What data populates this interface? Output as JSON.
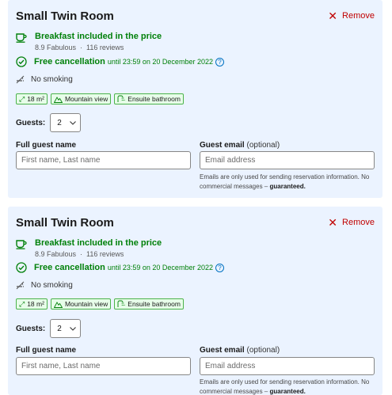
{
  "rooms": [
    {
      "title": "Small Twin Room",
      "remove_label": "Remove",
      "breakfast": "Breakfast included in the price",
      "rating_score": "8.9 Fabulous",
      "rating_reviews": "116 reviews",
      "rating_sep": "·",
      "cancel_label": "Free cancellation",
      "cancel_until": "until 23:59 on 20 December 2022",
      "help_glyph": "?",
      "no_smoking": "No smoking",
      "facilities": [
        "18 m²",
        "Mountain view",
        "Ensuite bathroom"
      ],
      "guests_label": "Guests:",
      "guests_value": "2",
      "name_label": "Full guest name",
      "name_placeholder": "First name, Last name",
      "email_label": "Guest email",
      "email_optional": "(optional)",
      "email_placeholder": "Email address",
      "email_note": "Emails are only used for sending reservation information. No commercial messages –",
      "email_note_bold": "guaranteed."
    },
    {
      "title": "Small Twin Room",
      "remove_label": "Remove",
      "breakfast": "Breakfast included in the price",
      "rating_score": "8.9 Fabulous",
      "rating_reviews": "116 reviews",
      "rating_sep": "·",
      "cancel_label": "Free cancellation",
      "cancel_until": "until 23:59 on 20 December 2022",
      "help_glyph": "?",
      "no_smoking": "No smoking",
      "facilities": [
        "18 m²",
        "Mountain view",
        "Ensuite bathroom"
      ],
      "guests_label": "Guests:",
      "guests_value": "2",
      "name_label": "Full guest name",
      "name_placeholder": "First name, Last name",
      "email_label": "Guest email",
      "email_optional": "(optional)",
      "email_placeholder": "Email address",
      "email_note": "Emails are only used for sending reservation information. No commercial messages –",
      "email_note_bold": "guaranteed."
    }
  ],
  "icons": {
    "remove": "close-icon",
    "breakfast": "coffee-cup-icon",
    "cancel": "check-circle-icon",
    "no_smoking": "no-smoking-icon",
    "size": "room-size-icon",
    "view": "mountain-icon",
    "bath": "shower-icon",
    "chevron": "chevron-down-icon"
  },
  "colors": {
    "card_bg": "#ebf3ff",
    "green": "#008009",
    "remove_red": "#c00000",
    "link_blue": "#0071c2"
  }
}
